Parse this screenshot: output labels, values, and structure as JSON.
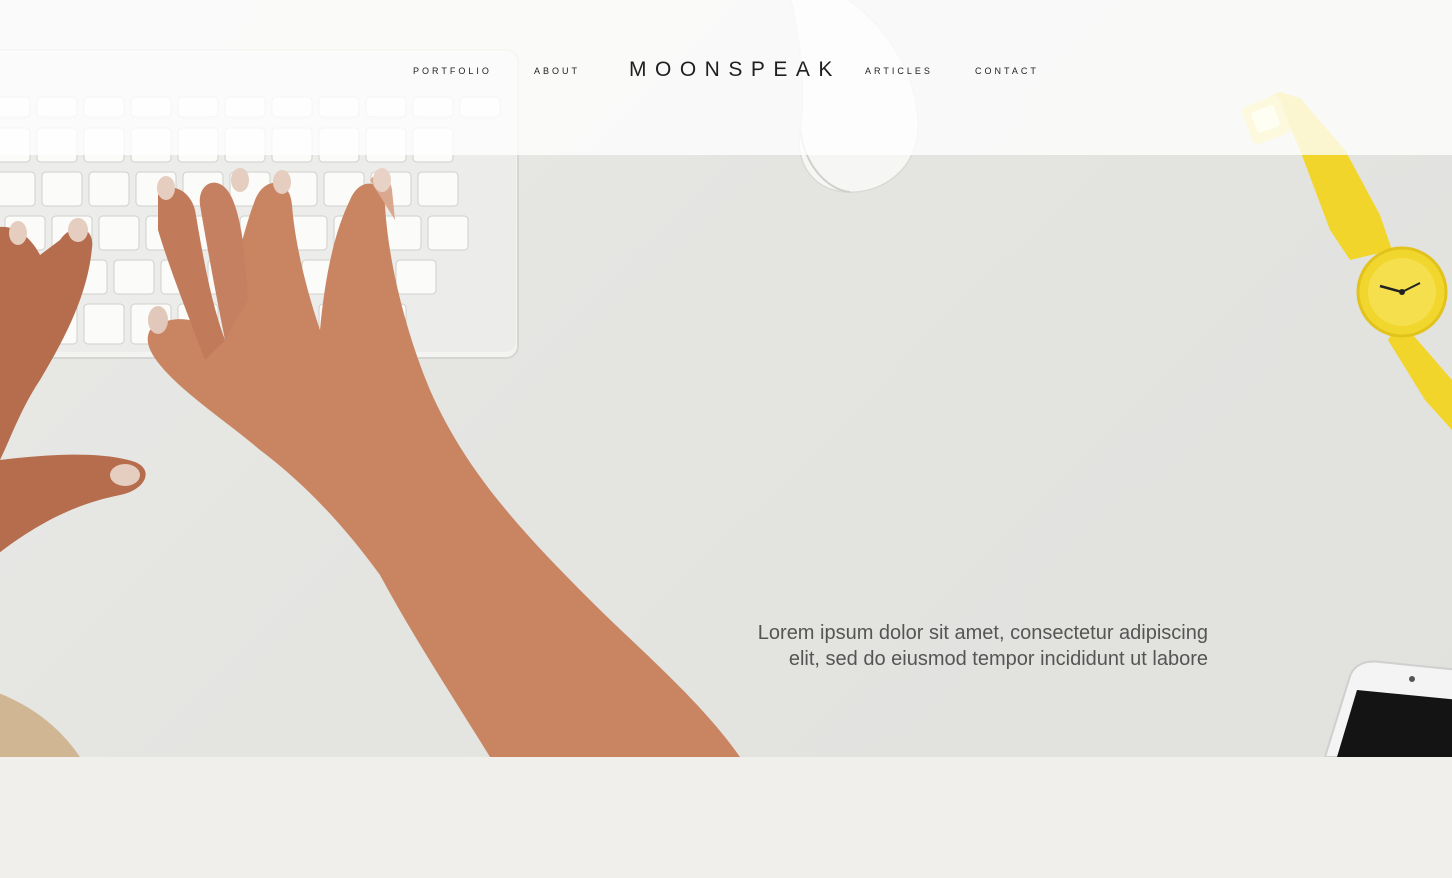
{
  "nav": {
    "brand": "MOONSPEAK",
    "items": [
      {
        "label": "PORTFOLIO"
      },
      {
        "label": "ABOUT"
      },
      {
        "label": "ARTICLES"
      },
      {
        "label": "CONTACT"
      }
    ]
  },
  "hero": {
    "tagline_line1": "Lorem ipsum dolor sit amet, consectetur adipiscing",
    "tagline_line2": "elit, sed do eiusmod tempor incididunt ut labore"
  },
  "colors": {
    "desk": "#e4e4e1",
    "lower_background": "#f0efeb",
    "watch_accent": "#f2d52a",
    "skin": "#c98562"
  }
}
